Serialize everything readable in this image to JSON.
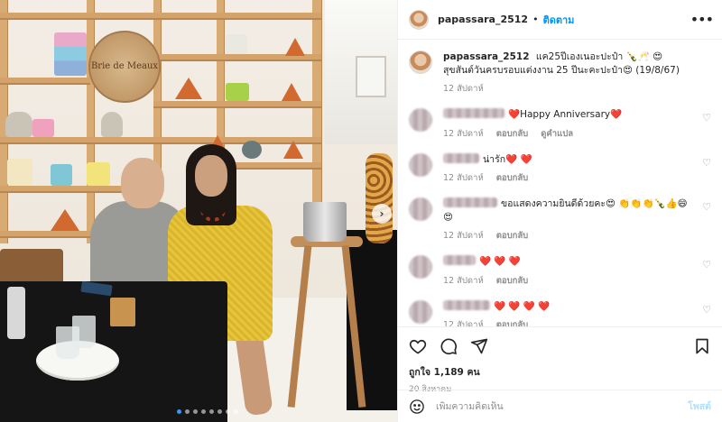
{
  "header": {
    "username": "papassara_2512",
    "separator": "•",
    "follow_label": "ติดตาม",
    "more_icon": "more-horizontal-icon"
  },
  "caption": {
    "username": "papassara_2512",
    "text": "แค25ปีเองเนอะปะป๋า 🍾🥂 😍 สุขสันต์วันครบรอบแต่งงาน 25 ปีนะคะปะป๋า😍 (19/8/67)",
    "time": "12 สัปดาห์"
  },
  "comments": [
    {
      "text": "❤️Happy Anniversary❤️",
      "time": "12 สัปดาห์",
      "reply_label": "ตอบกลับ",
      "extra": "ดูคำแปล"
    },
    {
      "text": "น่ารัก❤️ ❤️",
      "time": "12 สัปดาห์",
      "reply_label": "ตอบกลับ",
      "extra": ""
    },
    {
      "text": "ขอแสดงความยินดีด้วยคะ😍 👏👏👏🍾👍😄😍",
      "time": "12 สัปดาห์",
      "reply_label": "ตอบกลับ",
      "extra": ""
    },
    {
      "text": "❤️ ❤️ ❤️",
      "time": "12 สัปดาห์",
      "reply_label": "ตอบกลับ",
      "extra": ""
    },
    {
      "text": "❤️ ❤️ ❤️ ❤️",
      "time": "12 สัปดาห์",
      "reply_label": "ตอบกลับ",
      "extra": ""
    }
  ],
  "photo": {
    "brie_sign": "Brie de Meaux",
    "carousel_count": 8,
    "carousel_active": 0,
    "next_icon": "chevron-right-icon"
  },
  "actions": {
    "likes": "ถูกใจ 1,189 คน",
    "date": "20 สิงหาคม"
  },
  "add_comment": {
    "placeholder": "เพิ่มความคิดเห็น",
    "post_label": "โพสต์"
  },
  "colors": {
    "follow_blue": "#0095f6",
    "post_disabled": "#b2dffc",
    "meta_gray": "#8e8e8e"
  }
}
